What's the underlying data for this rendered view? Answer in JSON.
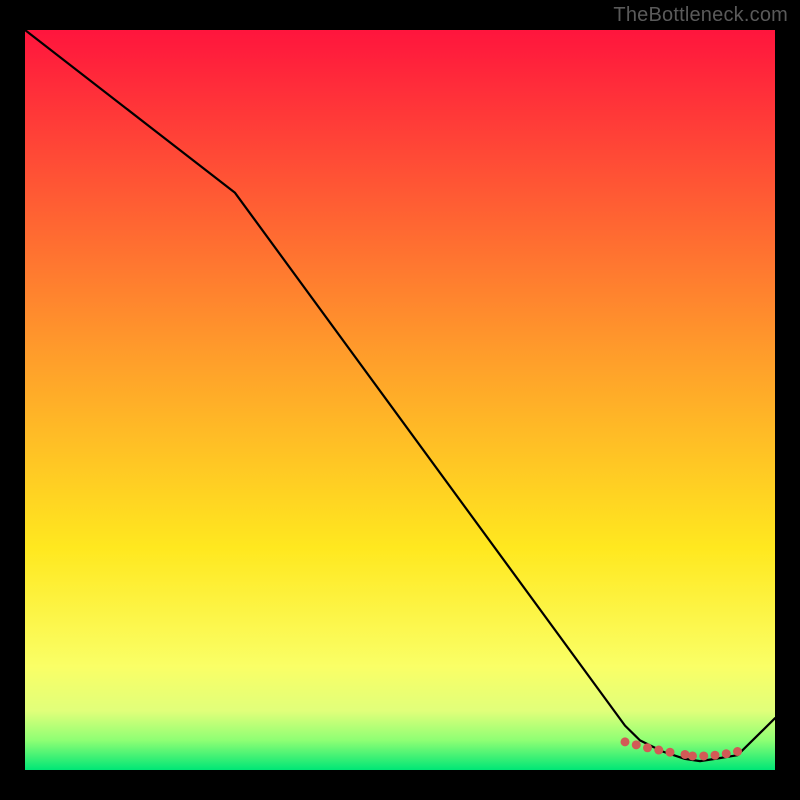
{
  "watermark": "TheBottleneck.com",
  "chart_data": {
    "type": "line",
    "title": "",
    "xlabel": "",
    "ylabel": "",
    "xlim": [
      0,
      100
    ],
    "ylim": [
      0,
      100
    ],
    "grid": false,
    "background": {
      "gradient_stops": [
        {
          "offset": 0,
          "color": "#ff153d"
        },
        {
          "offset": 43,
          "color": "#ff9a2b"
        },
        {
          "offset": 70,
          "color": "#ffe81f"
        },
        {
          "offset": 86,
          "color": "#faff66"
        },
        {
          "offset": 92,
          "color": "#e1ff7a"
        },
        {
          "offset": 96,
          "color": "#8eff74"
        },
        {
          "offset": 100,
          "color": "#00e676"
        }
      ]
    },
    "series": [
      {
        "name": "bottleneck-curve",
        "stroke": "#000000",
        "x": [
          0,
          28,
          80,
          82,
          85,
          88,
          90,
          92,
          95,
          100
        ],
        "values": [
          100,
          78,
          6,
          4,
          2.5,
          1.5,
          1.2,
          1.5,
          2,
          7
        ]
      }
    ],
    "markers": {
      "name": "optimal-range-dots",
      "color": "#d25a56",
      "x": [
        80,
        81.5,
        83,
        84.5,
        86,
        88,
        89,
        90.5,
        92,
        93.5,
        95
      ],
      "values": [
        3.8,
        3.4,
        3.0,
        2.7,
        2.4,
        2.1,
        1.9,
        1.9,
        2.0,
        2.2,
        2.5
      ]
    }
  }
}
